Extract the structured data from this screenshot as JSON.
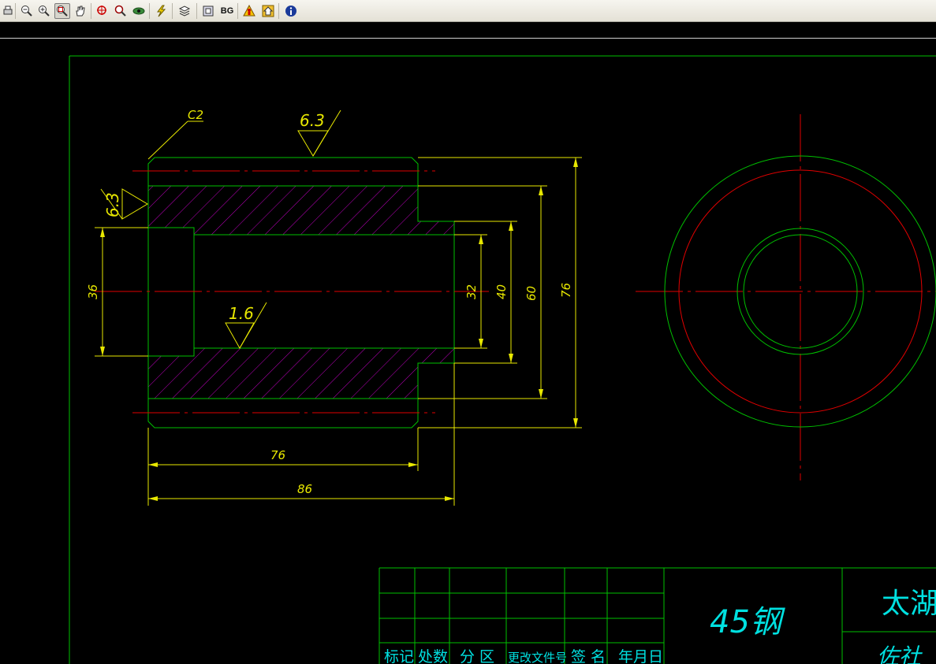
{
  "toolbar": {
    "buttons": [
      {
        "icon": "print-icon"
      },
      {
        "icon": "zoom-out-icon"
      },
      {
        "icon": "zoom-in-icon"
      },
      {
        "icon": "zoom-window-icon",
        "active": true
      },
      {
        "icon": "pan-hand-icon"
      },
      {
        "icon": "zoom-extents-icon"
      },
      {
        "icon": "zoom-realtime-icon"
      },
      {
        "icon": "layer-eye-icon"
      },
      {
        "icon": "lightning-icon"
      },
      {
        "icon": "layers-icon"
      },
      {
        "icon": "frame-icon"
      },
      {
        "icon": "bg-icon",
        "label": "BG"
      },
      {
        "icon": "warning-person-icon"
      },
      {
        "icon": "home-icon"
      },
      {
        "icon": "info-icon"
      }
    ]
  },
  "drawing": {
    "roughness_top": "6.3",
    "roughness_left": "6.3",
    "roughness_bore": "1.6",
    "chamfer": "C2",
    "dims": {
      "bore_left": "36",
      "bore_right": "32",
      "dia_40": "40",
      "dia_60": "60",
      "dia_76": "76",
      "len_76": "76",
      "len_86": "86"
    }
  },
  "title_block": {
    "material": "45钢",
    "company": "太湖",
    "sub_text": "佐社",
    "headers": [
      "标记",
      "处数",
      "分 区",
      "更改文件号",
      "签 名",
      "年月日"
    ]
  }
}
